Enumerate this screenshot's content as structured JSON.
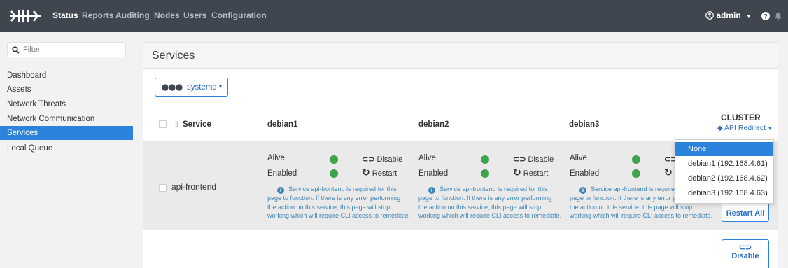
{
  "topnav": {
    "items": [
      {
        "label": "Status"
      },
      {
        "label": "Reports"
      },
      {
        "label": "Auditing"
      },
      {
        "label": "Nodes"
      },
      {
        "label": "Users"
      },
      {
        "label": "Configuration"
      }
    ],
    "user_label": "admin",
    "icons": [
      "logo-icon",
      "user-icon",
      "help-icon",
      "bell-icon"
    ]
  },
  "sidebar": {
    "filter_placeholder": "Filter",
    "items": [
      {
        "label": "Dashboard"
      },
      {
        "label": "Assets"
      },
      {
        "label": "Network Threats"
      },
      {
        "label": "Network Communication"
      },
      {
        "label": "Services"
      },
      {
        "label": "Local Queue"
      }
    ]
  },
  "main": {
    "title": "Services",
    "service_manager": "systemd",
    "columns": {
      "service": "Service",
      "nodes": [
        "debian1",
        "debian2",
        "debian3"
      ],
      "cluster": "CLUSTER",
      "cluster_action": "API Redirect"
    },
    "rows": [
      {
        "name": "api-frontend",
        "alive_label": "Alive",
        "enabled_label": "Enabled",
        "disable_label": "Disable",
        "restart_label": "Restart",
        "note": "Service api-frontend is required for this page to function. If there is any error performing the action on this service, this page will stop working which will require CLI access to remediate."
      }
    ],
    "cluster_buttons": {
      "restart_all": "Restart All",
      "disable_all": "Disable"
    },
    "dropdown": {
      "options": [
        "None",
        "debian1 (192.168.4.61)",
        "debian2 (192.168.4.62)",
        "debian3 (192.168.4.63)"
      ],
      "selected": "None"
    }
  },
  "colors": {
    "accent": "#2d83dc",
    "topbar": "#3f4650",
    "status_ok": "#3fa34d",
    "note_text": "#3e86b8"
  }
}
